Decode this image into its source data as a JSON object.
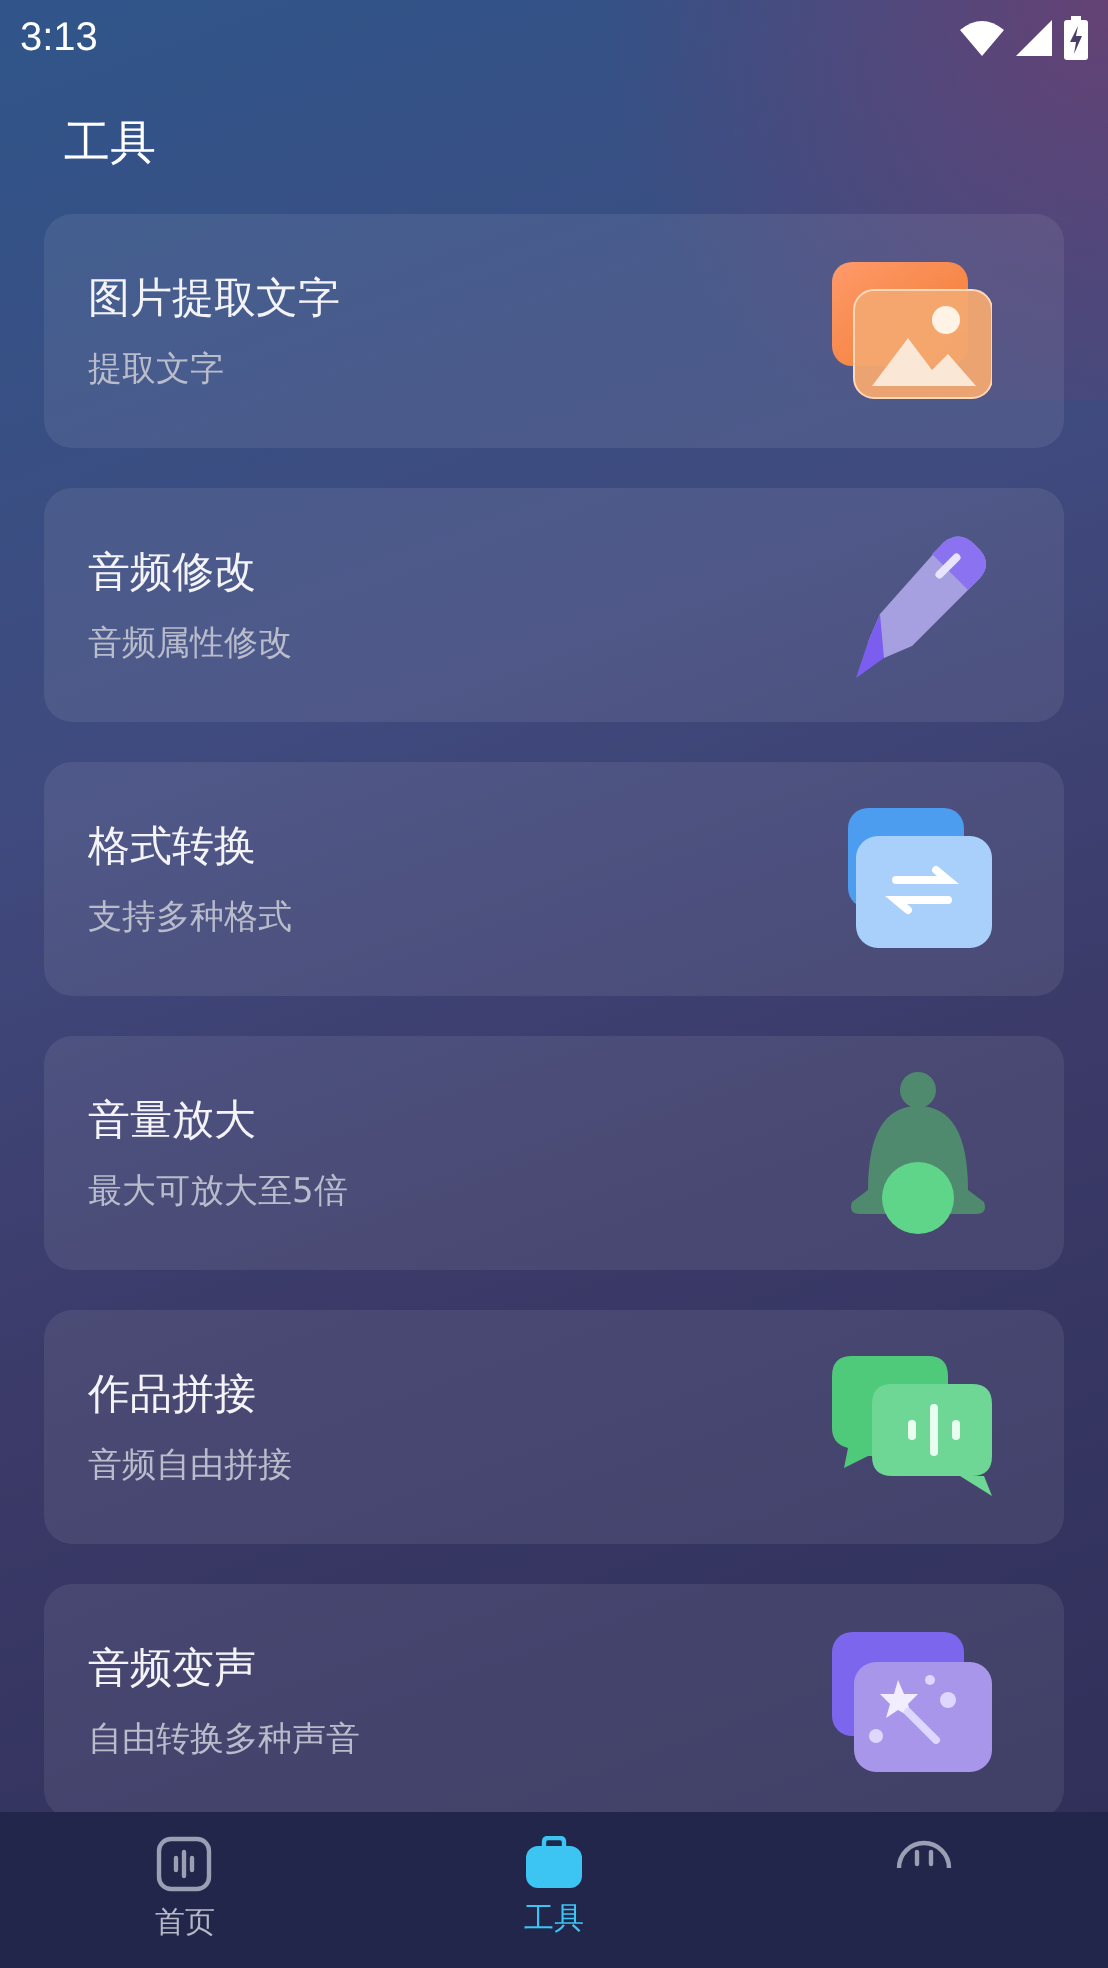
{
  "status_bar": {
    "time": "3:13"
  },
  "page_title": "工具",
  "tools": [
    {
      "title": "图片提取文字",
      "subtitle": "提取文字",
      "kind": "picture"
    },
    {
      "title": "音频修改",
      "subtitle": "音频属性修改",
      "kind": "pencil"
    },
    {
      "title": "格式转换",
      "subtitle": "支持多种格式",
      "kind": "convert"
    },
    {
      "title": "音量放大",
      "subtitle": "最大可放大至5倍",
      "kind": "bell"
    },
    {
      "title": "作品拼接",
      "subtitle": "音频自由拼接",
      "kind": "chat"
    },
    {
      "title": "音频变声",
      "subtitle": "自由转换多种声音",
      "kind": "wand"
    }
  ],
  "tabs": [
    {
      "label": "首页",
      "kind": "home",
      "selected": false
    },
    {
      "label": "工具",
      "kind": "bag",
      "selected": true
    },
    {
      "kind": "face",
      "selected": false
    }
  ]
}
